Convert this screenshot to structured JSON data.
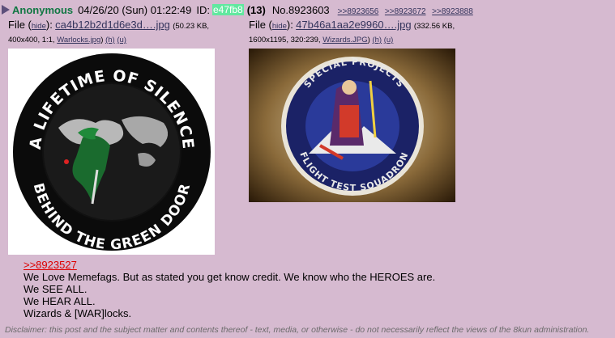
{
  "post": {
    "name": "Anonymous",
    "date": "04/26/20 (Sun) 01:22:49",
    "id_label": "ID:",
    "id_value": "e47fb8",
    "reply_count": "(13)",
    "post_number": "No.8923603",
    "backlinks": [
      ">>8923656",
      ">>8923672",
      ">>8923888"
    ]
  },
  "files": [
    {
      "label": "File (",
      "hide": "hide",
      "after_hide": "):",
      "filename": "ca4b12b2d1d6e3d….jpg",
      "size": "(50.23 KB,",
      "dims": "400x400, 1:1,",
      "orig": "Warlocks.jpg",
      "close": ")",
      "h": "(h)",
      "u": "(u)",
      "patch_top_text": "A LIFETIME OF SILENCE",
      "patch_bottom_text": "BEHIND THE GREEN DOOR"
    },
    {
      "label": "File (",
      "hide": "hide",
      "after_hide": "):",
      "filename": "47b46a1aa2e9960….jpg",
      "size": "(332.56 KB,",
      "dims": "1600x1195, 320:239,",
      "orig": "Wizards.JPG",
      "close": ")",
      "h": "(h)",
      "u": "(u)",
      "patch_top_text": "SPECIAL PROJECTS",
      "patch_bottom_text": "FLIGHT TEST SQUADRON"
    }
  ],
  "message": {
    "quote": ">>8923527",
    "lines": [
      "We Love Memefags. But as stated you get know credit. We know who the HEROES are.",
      "We SEE ALL.",
      "We HEAR ALL.",
      "Wizards & [WAR]locks."
    ]
  },
  "disclaimer": "Disclaimer: this post and the subject matter and contents thereof - text, media, or otherwise - do not necessarily reflect the views of the 8kun administration."
}
